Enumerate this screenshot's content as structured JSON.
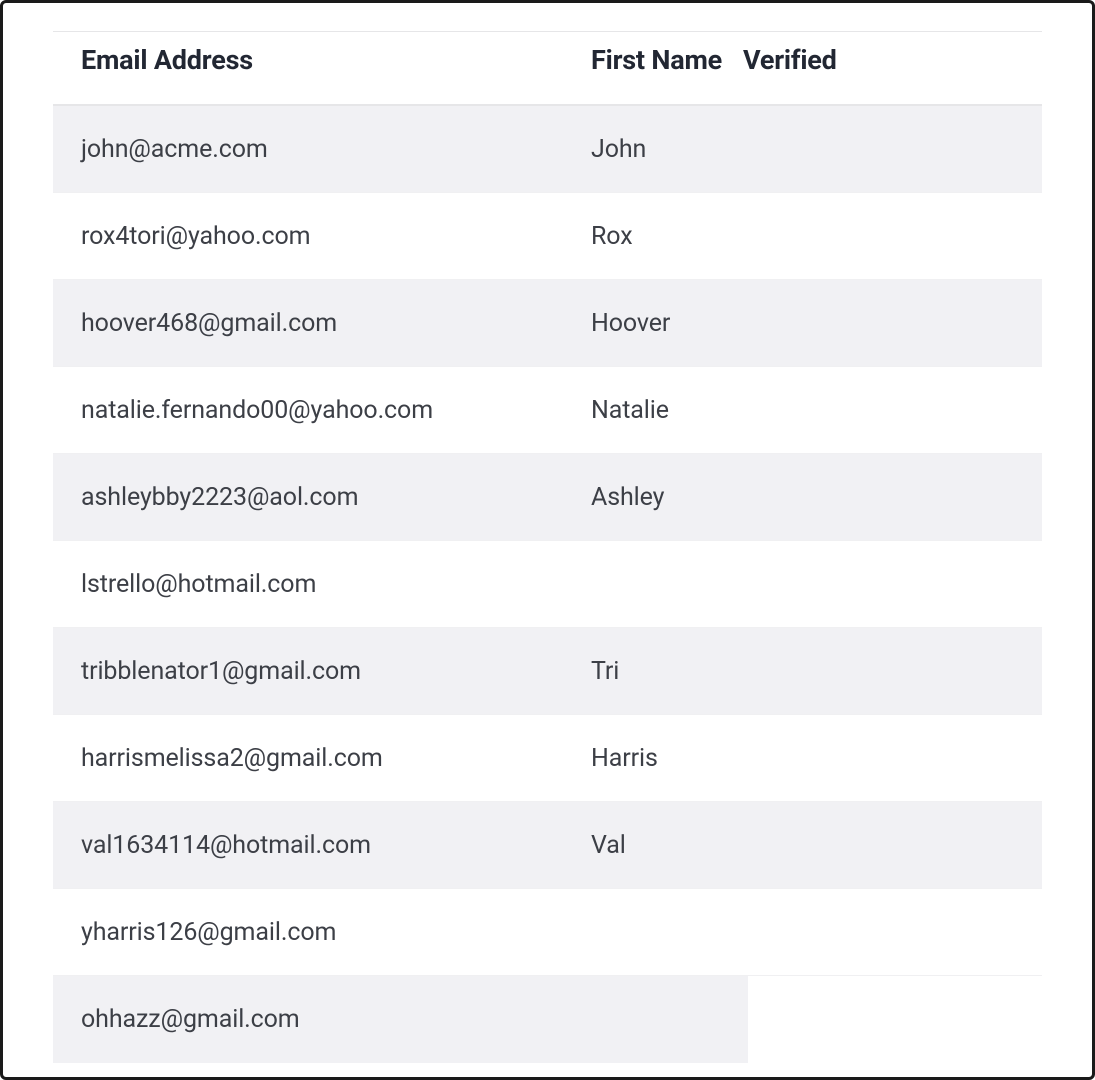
{
  "table": {
    "headers": {
      "email": "Email Address",
      "first_name": "First Name",
      "verified": "Verified"
    },
    "rows": [
      {
        "email": "john@acme.com",
        "first_name": "John",
        "verified": ""
      },
      {
        "email": "rox4tori@yahoo.com",
        "first_name": "Rox",
        "verified": ""
      },
      {
        "email": "hoover468@gmail.com",
        "first_name": "Hoover",
        "verified": ""
      },
      {
        "email": "natalie.fernando00@yahoo.com",
        "first_name": "Natalie",
        "verified": ""
      },
      {
        "email": "ashleybby2223@aol.com",
        "first_name": "Ashley",
        "verified": ""
      },
      {
        "email": "lstrello@hotmail.com",
        "first_name": "",
        "verified": ""
      },
      {
        "email": "tribblenator1@gmail.com",
        "first_name": "Tri",
        "verified": ""
      },
      {
        "email": "harrismelissa2@gmail.com",
        "first_name": "Harris",
        "verified": ""
      },
      {
        "email": "val1634114@hotmail.com",
        "first_name": "Val",
        "verified": ""
      },
      {
        "email": "yharris126@gmail.com",
        "first_name": "",
        "verified": ""
      },
      {
        "email": "ohhazz@gmail.com",
        "first_name": "",
        "verified": ""
      }
    ]
  }
}
